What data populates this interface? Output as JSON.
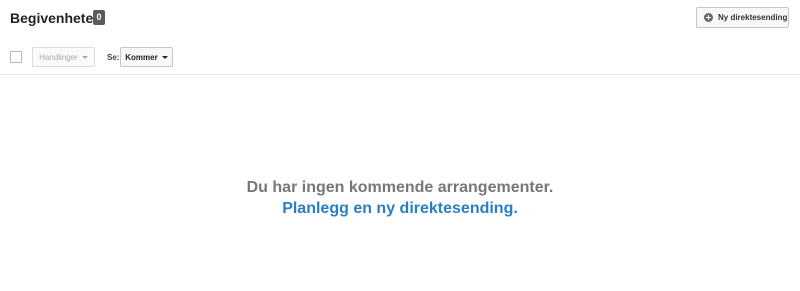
{
  "header": {
    "title": "Begivenheter",
    "count": "0",
    "new_live_label": "Ny direktesending",
    "new_live_icon": "plus-circle-icon"
  },
  "toolbar": {
    "actions_label": "Handlinger",
    "view_label": "Se:",
    "view_selected": "Kommer"
  },
  "empty_state": {
    "message": "Du har ingen kommende arrangementer.",
    "link_label": "Planlegg en ny direktesending."
  },
  "colors": {
    "link": "#2a7ec4",
    "badge": "#5c5c5c",
    "muted_text": "#777777"
  }
}
